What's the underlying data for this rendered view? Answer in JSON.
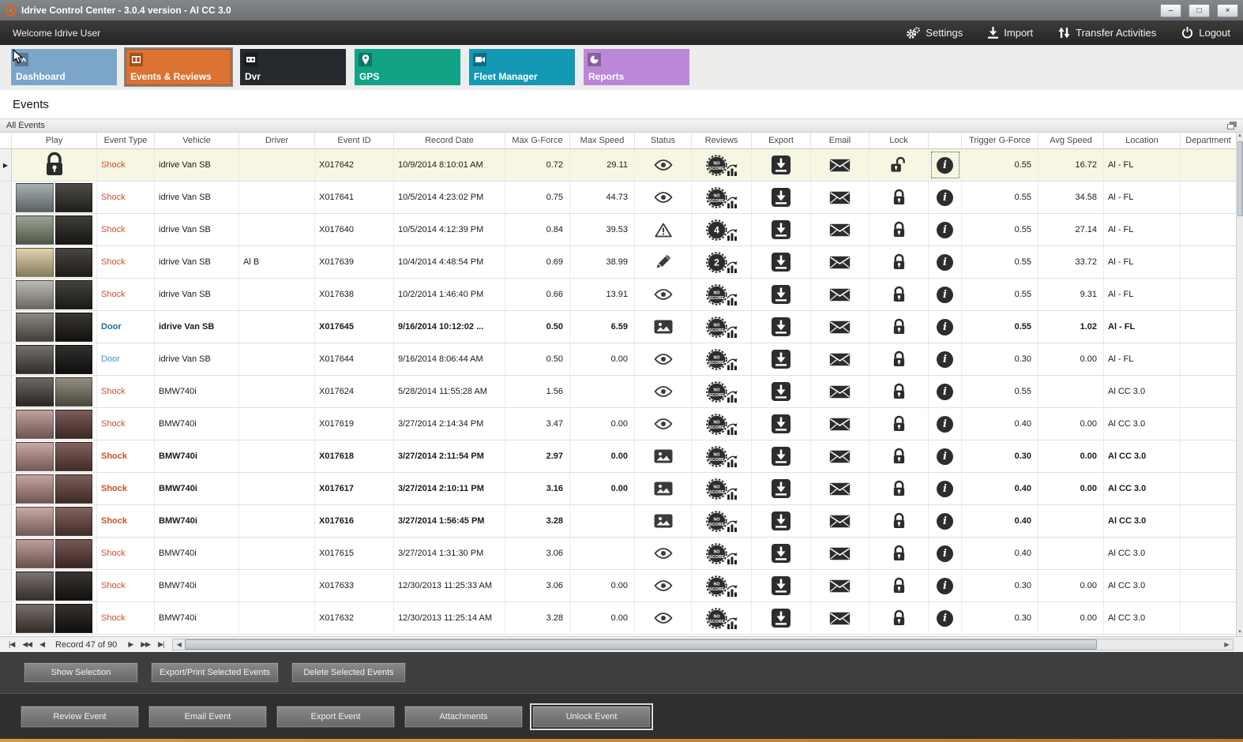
{
  "window": {
    "title": "Idrive Control Center - 3.0.4 version - Al CC 3.0",
    "controls": {
      "minimize": "–",
      "maximize": "□",
      "close": "×"
    }
  },
  "topbar": {
    "welcome": "Welcome Idrive User",
    "actions": [
      {
        "id": "settings",
        "label": "Settings"
      },
      {
        "id": "import",
        "label": "Import"
      },
      {
        "id": "transfer",
        "label": "Transfer Activities"
      },
      {
        "id": "logout",
        "label": "Logout"
      }
    ]
  },
  "nav_tiles": [
    {
      "label": "Dashboard",
      "color": "#7ba6c9",
      "selected": false
    },
    {
      "label": "Events & Reviews",
      "color": "#dc7232",
      "selected": true
    },
    {
      "label": "Dvr",
      "color": "#25292d",
      "selected": false
    },
    {
      "label": "GPS",
      "color": "#12a387",
      "selected": false
    },
    {
      "label": "Fleet Manager",
      "color": "#1399b4",
      "selected": false
    },
    {
      "label": "Reports",
      "color": "#bc87d8",
      "selected": false
    }
  ],
  "page": {
    "title": "Events",
    "group": "All Events"
  },
  "colors": {
    "accent_orange": "#dc7232",
    "selected_row": "#f6f6e3",
    "shock_text": "#cb4f2c",
    "door_text": "#3f93c8",
    "door_text_bold": "#1d6da6",
    "bottom_strip": "#bd762a"
  },
  "icons": {
    "settings": "gear-icon",
    "import": "import-icon",
    "transfer": "transfer-icon",
    "logout": "power-icon",
    "status_eye": "eye-icon",
    "status_warning": "warning-icon",
    "status_pencil": "pencil-icon",
    "status_image": "image-icon",
    "review_badge": "score-badge-icon",
    "review_chart": "chart-icon",
    "export": "download-icon",
    "email": "envelope-icon",
    "lock": "padlock-icon",
    "info": "info-icon"
  },
  "table": {
    "columns": [
      "",
      "Play",
      "Event Type",
      "Vehicle",
      "Driver",
      "Event ID",
      "Record Date",
      "Max G-Force",
      "Max Speed",
      "Status",
      "Reviews",
      "Export",
      "Email",
      "Lock",
      "",
      "Trigger G-Force",
      "Avg Speed",
      "Location",
      "Department"
    ],
    "rows": [
      {
        "selected": true,
        "bold": false,
        "thumb": "lock",
        "event_type": "Shock",
        "vehicle": "idrive Van SB",
        "driver": "",
        "event_id": "X017642",
        "record_date": "10/9/2014 8:10:01 AM",
        "max_g": "0.72",
        "max_speed": "29.11",
        "status": "eye",
        "review": "NO SCORE",
        "lock": "unlocked",
        "trigger_g": "0.55",
        "avg_speed": "16.72",
        "location": "Al - FL"
      },
      {
        "selected": false,
        "bold": false,
        "thumb": [
          "#8f9c9e",
          "#3a3733"
        ],
        "event_type": "Shock",
        "vehicle": "idrive Van SB",
        "driver": "",
        "event_id": "X017641",
        "record_date": "10/5/2014 4:23:02 PM",
        "max_g": "0.75",
        "max_speed": "44.73",
        "status": "eye",
        "review": "NO SCORE",
        "lock": "locked",
        "trigger_g": "0.55",
        "avg_speed": "34.58",
        "location": "Al - FL"
      },
      {
        "selected": false,
        "bold": false,
        "thumb": [
          "#7f8b76",
          "#2b2823"
        ],
        "event_type": "Shock",
        "vehicle": "idrive Van SB",
        "driver": "",
        "event_id": "X017640",
        "record_date": "10/5/2014 4:12:39 PM",
        "max_g": "0.84",
        "max_speed": "39.53",
        "status": "warning",
        "review": "4",
        "lock": "locked",
        "trigger_g": "0.55",
        "avg_speed": "27.14",
        "location": "Al - FL"
      },
      {
        "selected": false,
        "bold": false,
        "thumb": [
          "#d8c897",
          "#35312b"
        ],
        "event_type": "Shock",
        "vehicle": "idrive Van SB",
        "driver": "Al B",
        "event_id": "X017639",
        "record_date": "10/4/2014 4:48:54 PM",
        "max_g": "0.69",
        "max_speed": "38.99",
        "status": "pencil",
        "review": "2",
        "lock": "locked",
        "trigger_g": "0.55",
        "avg_speed": "33.72",
        "location": "Al - FL"
      },
      {
        "selected": false,
        "bold": false,
        "thumb": [
          "#a9a79c",
          "#2f2d29"
        ],
        "event_type": "Shock",
        "vehicle": "idrive Van SB",
        "driver": "",
        "event_id": "X017638",
        "record_date": "10/2/2014 1:46:40 PM",
        "max_g": "0.66",
        "max_speed": "13.91",
        "status": "eye",
        "review": "NO SCORE",
        "lock": "locked",
        "trigger_g": "0.55",
        "avg_speed": "9.31",
        "location": "Al - FL"
      },
      {
        "selected": false,
        "bold": true,
        "thumb": [
          "#6b675a",
          "#232019"
        ],
        "event_type": "Door",
        "vehicle": "idrive Van SB",
        "driver": "",
        "event_id": "X017645",
        "record_date": "9/16/2014 10:12:02 ...",
        "max_g": "0.50",
        "max_speed": "6.59",
        "status": "image",
        "review": "NO SCORE",
        "lock": "locked",
        "trigger_g": "0.55",
        "avg_speed": "1.02",
        "location": "Al - FL"
      },
      {
        "selected": false,
        "bold": false,
        "thumb": [
          "#4e4a43",
          "#1b1917"
        ],
        "event_type": "Door",
        "vehicle": "idrive Van SB",
        "driver": "",
        "event_id": "X017644",
        "record_date": "9/16/2014 8:06:44 AM",
        "max_g": "0.50",
        "max_speed": "0.00",
        "status": "eye",
        "review": "NO SCORE",
        "lock": "locked",
        "trigger_g": "0.30",
        "avg_speed": "0.00",
        "location": "Al - FL"
      },
      {
        "selected": false,
        "bold": false,
        "thumb": [
          "#433f39",
          "#878170"
        ],
        "event_type": "Shock",
        "vehicle": "BMW740i",
        "driver": "",
        "event_id": "X017624",
        "record_date": "5/28/2014 11:55:28 AM",
        "max_g": "1.56",
        "max_speed": "",
        "status": "eye",
        "review": "NO SCORE",
        "lock": "locked",
        "trigger_g": "0.55",
        "avg_speed": "",
        "location": "Al CC 3.0"
      },
      {
        "selected": false,
        "bold": false,
        "thumb": [
          "#b08884",
          "#6d4a45"
        ],
        "event_type": "Shock",
        "vehicle": "BMW740i",
        "driver": "",
        "event_id": "X017619",
        "record_date": "3/27/2014 2:14:34 PM",
        "max_g": "3.47",
        "max_speed": "0.00",
        "status": "eye",
        "review": "NO SCORE",
        "lock": "locked",
        "trigger_g": "0.40",
        "avg_speed": "0.00",
        "location": "Al CC 3.0"
      },
      {
        "selected": false,
        "bold": true,
        "thumb": [
          "#bb918c",
          "#75504b"
        ],
        "event_type": "Shock",
        "vehicle": "BMW740i",
        "driver": "",
        "event_id": "X017618",
        "record_date": "3/27/2014 2:11:54 PM",
        "max_g": "2.97",
        "max_speed": "0.00",
        "status": "image",
        "review": "NO SCORE",
        "lock": "locked",
        "trigger_g": "0.30",
        "avg_speed": "0.00",
        "location": "Al CC 3.0"
      },
      {
        "selected": false,
        "bold": true,
        "thumb": [
          "#b58b86",
          "#6f4c47"
        ],
        "event_type": "Shock",
        "vehicle": "BMW740i",
        "driver": "",
        "event_id": "X017617",
        "record_date": "3/27/2014 2:10:11 PM",
        "max_g": "3.16",
        "max_speed": "0.00",
        "status": "image",
        "review": "NO SCORE",
        "lock": "locked",
        "trigger_g": "0.40",
        "avg_speed": "0.00",
        "location": "Al CC 3.0"
      },
      {
        "selected": false,
        "bold": true,
        "thumb": [
          "#b9908a",
          "#77514c"
        ],
        "event_type": "Shock",
        "vehicle": "BMW740i",
        "driver": "",
        "event_id": "X017616",
        "record_date": "3/27/2014 1:56:45 PM",
        "max_g": "3.28",
        "max_speed": "",
        "status": "image",
        "review": "NO SCORE",
        "lock": "locked",
        "trigger_g": "0.40",
        "avg_speed": "",
        "location": "Al CC 3.0"
      },
      {
        "selected": false,
        "bold": false,
        "thumb": [
          "#ab847f",
          "#684642"
        ],
        "event_type": "Shock",
        "vehicle": "BMW740i",
        "driver": "",
        "event_id": "X017615",
        "record_date": "3/27/2014 1:31:30 PM",
        "max_g": "3.06",
        "max_speed": "",
        "status": "eye",
        "review": "NO SCORE",
        "lock": "locked",
        "trigger_g": "0.40",
        "avg_speed": "",
        "location": "Al CC 3.0"
      },
      {
        "selected": false,
        "bold": false,
        "thumb": [
          "#554c45",
          "#221e1b"
        ],
        "event_type": "Shock",
        "vehicle": "BMW740i",
        "driver": "",
        "event_id": "X017633",
        "record_date": "12/30/2013 11:25:33 AM",
        "max_g": "3.06",
        "max_speed": "0.00",
        "status": "eye",
        "review": "NO SCORE",
        "lock": "locked",
        "trigger_g": "0.30",
        "avg_speed": "0.00",
        "location": "Al CC 3.0"
      },
      {
        "selected": false,
        "bold": false,
        "thumb": [
          "#514840",
          "#1f1b18"
        ],
        "event_type": "Shock",
        "vehicle": "BMW740i",
        "driver": "",
        "event_id": "X017632",
        "record_date": "12/30/2013 11:25:14 AM",
        "max_g": "3.28",
        "max_speed": "0.00",
        "status": "eye",
        "review": "NO SCORE",
        "lock": "locked",
        "trigger_g": "0.30",
        "avg_speed": "0.00",
        "location": "Al CC 3.0"
      }
    ]
  },
  "pager": {
    "label": "Record 47 of 90"
  },
  "selection_bar": {
    "buttons": [
      "Show Selection",
      "Export/Print Selected Events",
      "Delete Selected  Events"
    ]
  },
  "event_bar": {
    "buttons": [
      "Review Event",
      "Email Event",
      "Export Event",
      "Attachments",
      "Unlock Event"
    ],
    "focused": "Unlock Event"
  }
}
